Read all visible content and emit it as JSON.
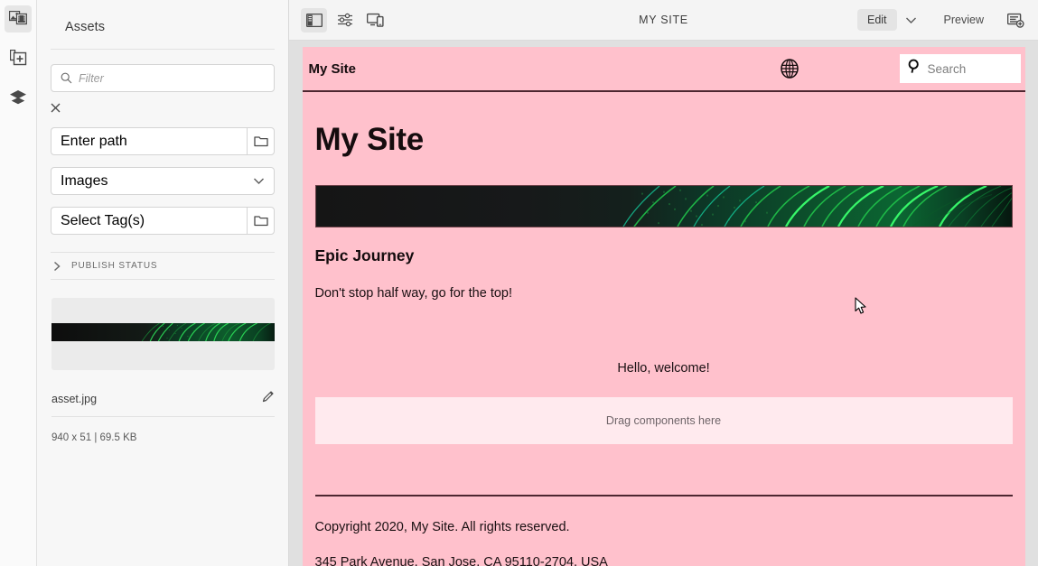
{
  "rail": {
    "items": [
      {
        "name": "assets-rail-icon",
        "label": "Assets",
        "active": true
      },
      {
        "name": "components-rail-icon",
        "label": "Components",
        "active": false
      },
      {
        "name": "layers-rail-icon",
        "label": "Layers",
        "active": false
      }
    ]
  },
  "panel": {
    "title": "Assets",
    "filter": {
      "placeholder": "Filter",
      "value": ""
    },
    "clear_label": "×",
    "path": {
      "placeholder": "Enter path",
      "value": ""
    },
    "type_select": {
      "value": "Images"
    },
    "tags": {
      "placeholder": "Select Tag(s)",
      "value": ""
    },
    "accordion": {
      "label": "PUBLISH STATUS",
      "expanded": false
    },
    "asset": {
      "file_name": "asset.jpg",
      "meta": "940 x 51 | 69.5 KB"
    }
  },
  "toolbar": {
    "title": "MY SITE",
    "edit_label": "Edit",
    "preview_label": "Preview",
    "icons": {
      "panel_toggle": "sidebar-toggle-icon",
      "settings": "sliders-icon",
      "responsive": "device-preview-icon",
      "chevron": "chevron-down-icon",
      "annotate": "page-annotate-icon"
    }
  },
  "canvas": {
    "header": {
      "brand": "My Site",
      "globe_icon": "globe-icon",
      "search_placeholder": "Search"
    },
    "hero_title": "My Site",
    "section_title": "Epic Journey",
    "section_text": "Don't stop half way, go for the top!",
    "welcome_text": "Hello, welcome!",
    "dropzone_text": "Drag components here",
    "footer": {
      "copyright": "Copyright 2020, My Site. All rights reserved.",
      "address": "345 Park Avenue, San Jose, CA 95110-2704, USA"
    }
  },
  "colors": {
    "site_pink": "#ffc1cc",
    "dropzone_pink": "#ffeaee",
    "site_rule": "#4d2730",
    "accent_green": "#24d24a"
  }
}
